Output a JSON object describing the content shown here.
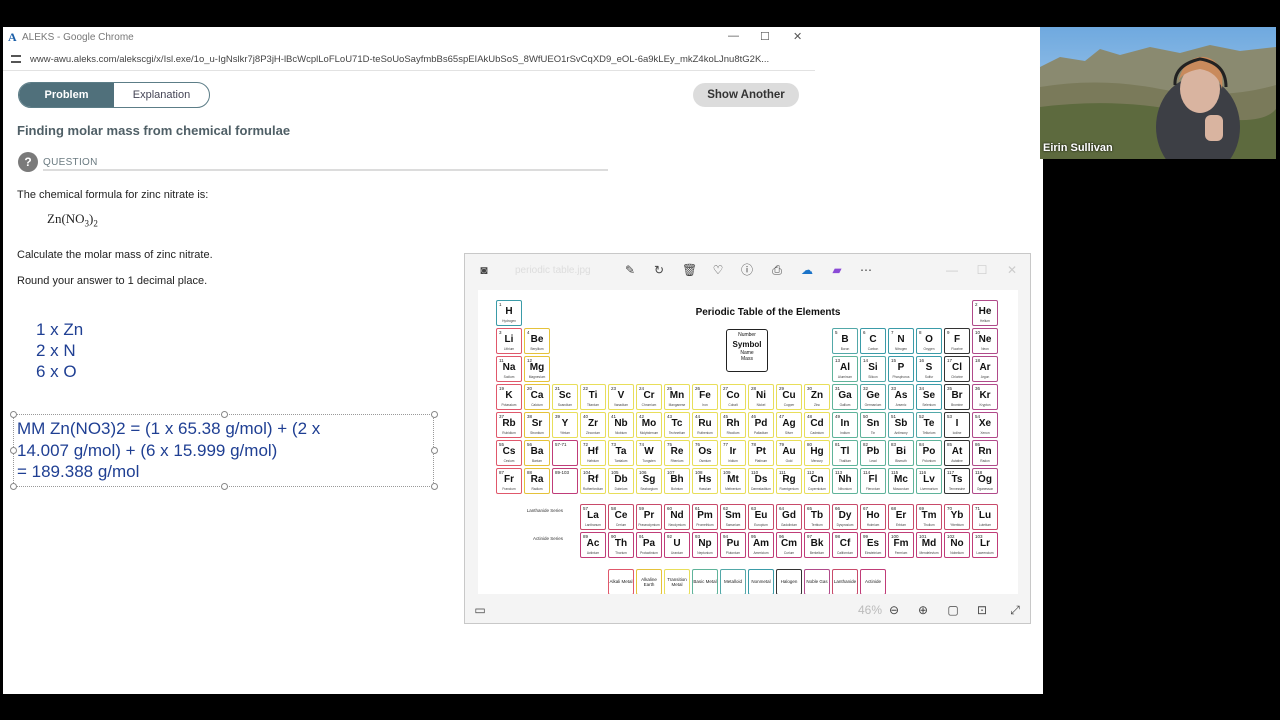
{
  "window": {
    "title": "ALEKS - Google Chrome",
    "logo_letter": "A",
    "url": "www-awu.aleks.com/alekscgi/x/Isl.exe/1o_u-IgNslkr7j8P3jH-lBcWcplLoFLoU71D-teSoUoSayfmbBs65spEIAkUbSoS_8WfUEO1rSvCqXD9_eOL-6a9kLEy_mkZ4koLJnu8tG2K..."
  },
  "tabs": {
    "problem": "Problem",
    "explanation": "Explanation"
  },
  "show_another": "Show Another",
  "heading": "Finding molar mass from chemical formulae",
  "question": {
    "icon": "?",
    "label": "QUESTION",
    "line1": "The chemical formula for zinc nitrate is:",
    "formula_main": "Zn(NO",
    "formula_sub1": "3",
    "formula_close": ")",
    "formula_sub2": "2",
    "line2": "Calculate the molar mass of zinc nitrate.",
    "line3": "Round your answer to 1 decimal place."
  },
  "handwriting": {
    "count1": "1 x Zn",
    "count2": "2 x N",
    "count3": "6 x O",
    "mm1": "MM Zn(NO3)2 = (1 x 65.38 g/mol) + (2 x",
    "mm2": "14.007 g/mol) + (6 x 15.999 g/mol)",
    "mm3": "= 189.388 g/mol"
  },
  "viewer": {
    "filename": "periodic table.jpg",
    "image_title": "Periodic Table of the Elements",
    "legend_number": "Number",
    "legend_symbol": "Symbol",
    "legend_name": "Name",
    "legend_mass": "Mass",
    "lanthanide_label": "Lanthanide Series",
    "actinide_label": "Actinide Series",
    "zoom": "46%"
  },
  "periodic": {
    "main": [
      [
        "1",
        "H",
        "Hydrogen"
      ],
      [
        "2",
        "He",
        "Helium"
      ],
      [
        "3",
        "Li",
        "Lithium"
      ],
      [
        "4",
        "Be",
        "Beryllium"
      ],
      [
        "5",
        "B",
        "Boron"
      ],
      [
        "6",
        "C",
        "Carbon"
      ],
      [
        "7",
        "N",
        "Nitrogen"
      ],
      [
        "8",
        "O",
        "Oxygen"
      ],
      [
        "9",
        "F",
        "Fluorine"
      ],
      [
        "10",
        "Ne",
        "Neon"
      ],
      [
        "11",
        "Na",
        "Sodium"
      ],
      [
        "12",
        "Mg",
        "Magnesium"
      ],
      [
        "13",
        "Al",
        "Aluminum"
      ],
      [
        "14",
        "Si",
        "Silicon"
      ],
      [
        "15",
        "P",
        "Phosphorus"
      ],
      [
        "16",
        "S",
        "Sulfur"
      ],
      [
        "17",
        "Cl",
        "Chlorine"
      ],
      [
        "18",
        "Ar",
        "Argon"
      ],
      [
        "19",
        "K",
        "Potassium"
      ],
      [
        "20",
        "Ca",
        "Calcium"
      ],
      [
        "21",
        "Sc",
        "Scandium"
      ],
      [
        "22",
        "Ti",
        "Titanium"
      ],
      [
        "23",
        "V",
        "Vanadium"
      ],
      [
        "24",
        "Cr",
        "Chromium"
      ],
      [
        "25",
        "Mn",
        "Manganese"
      ],
      [
        "26",
        "Fe",
        "Iron"
      ],
      [
        "27",
        "Co",
        "Cobalt"
      ],
      [
        "28",
        "Ni",
        "Nickel"
      ],
      [
        "29",
        "Cu",
        "Copper"
      ],
      [
        "30",
        "Zn",
        "Zinc"
      ],
      [
        "31",
        "Ga",
        "Gallium"
      ],
      [
        "32",
        "Ge",
        "Germanium"
      ],
      [
        "33",
        "As",
        "Arsenic"
      ],
      [
        "34",
        "Se",
        "Selenium"
      ],
      [
        "35",
        "Br",
        "Bromine"
      ],
      [
        "36",
        "Kr",
        "Krypton"
      ],
      [
        "37",
        "Rb",
        "Rubidium"
      ],
      [
        "38",
        "Sr",
        "Strontium"
      ],
      [
        "39",
        "Y",
        "Yttrium"
      ],
      [
        "40",
        "Zr",
        "Zirconium"
      ],
      [
        "41",
        "Nb",
        "Niobium"
      ],
      [
        "42",
        "Mo",
        "Molybdenum"
      ],
      [
        "43",
        "Tc",
        "Technetium"
      ],
      [
        "44",
        "Ru",
        "Ruthenium"
      ],
      [
        "45",
        "Rh",
        "Rhodium"
      ],
      [
        "46",
        "Pd",
        "Palladium"
      ],
      [
        "47",
        "Ag",
        "Silver"
      ],
      [
        "48",
        "Cd",
        "Cadmium"
      ],
      [
        "49",
        "In",
        "Indium"
      ],
      [
        "50",
        "Sn",
        "Tin"
      ],
      [
        "51",
        "Sb",
        "Antimony"
      ],
      [
        "52",
        "Te",
        "Tellurium"
      ],
      [
        "53",
        "I",
        "Iodine"
      ],
      [
        "54",
        "Xe",
        "Xenon"
      ],
      [
        "55",
        "Cs",
        "Cesium"
      ],
      [
        "56",
        "Ba",
        "Barium"
      ],
      [
        "57-71",
        "",
        ""
      ],
      [
        "72",
        "Hf",
        "Hafnium"
      ],
      [
        "73",
        "Ta",
        "Tantalum"
      ],
      [
        "74",
        "W",
        "Tungsten"
      ],
      [
        "75",
        "Re",
        "Rhenium"
      ],
      [
        "76",
        "Os",
        "Osmium"
      ],
      [
        "77",
        "Ir",
        "Iridium"
      ],
      [
        "78",
        "Pt",
        "Platinum"
      ],
      [
        "79",
        "Au",
        "Gold"
      ],
      [
        "80",
        "Hg",
        "Mercury"
      ],
      [
        "81",
        "Tl",
        "Thallium"
      ],
      [
        "82",
        "Pb",
        "Lead"
      ],
      [
        "83",
        "Bi",
        "Bismuth"
      ],
      [
        "84",
        "Po",
        "Polonium"
      ],
      [
        "85",
        "At",
        "Astatine"
      ],
      [
        "86",
        "Rn",
        "Radon"
      ],
      [
        "87",
        "Fr",
        "Francium"
      ],
      [
        "88",
        "Ra",
        "Radium"
      ],
      [
        "89-103",
        "",
        ""
      ],
      [
        "104",
        "Rf",
        "Rutherfordium"
      ],
      [
        "105",
        "Db",
        "Dubnium"
      ],
      [
        "106",
        "Sg",
        "Seaborgium"
      ],
      [
        "107",
        "Bh",
        "Bohrium"
      ],
      [
        "108",
        "Hs",
        "Hassium"
      ],
      [
        "109",
        "Mt",
        "Meitnerium"
      ],
      [
        "110",
        "Ds",
        "Darmstadtium"
      ],
      [
        "111",
        "Rg",
        "Roentgenium"
      ],
      [
        "112",
        "Cn",
        "Copernicium"
      ],
      [
        "113",
        "Nh",
        "Nihonium"
      ],
      [
        "114",
        "Fl",
        "Flerovium"
      ],
      [
        "115",
        "Mc",
        "Moscovium"
      ],
      [
        "116",
        "Lv",
        "Livermorium"
      ],
      [
        "117",
        "Ts",
        "Tennessine"
      ],
      [
        "118",
        "Og",
        "Oganesson"
      ]
    ],
    "lanthanides": [
      [
        "57",
        "La",
        "Lanthanum"
      ],
      [
        "58",
        "Ce",
        "Cerium"
      ],
      [
        "59",
        "Pr",
        "Praseodymium"
      ],
      [
        "60",
        "Nd",
        "Neodymium"
      ],
      [
        "61",
        "Pm",
        "Promethium"
      ],
      [
        "62",
        "Sm",
        "Samarium"
      ],
      [
        "63",
        "Eu",
        "Europium"
      ],
      [
        "64",
        "Gd",
        "Gadolinium"
      ],
      [
        "65",
        "Tb",
        "Terbium"
      ],
      [
        "66",
        "Dy",
        "Dysprosium"
      ],
      [
        "67",
        "Ho",
        "Holmium"
      ],
      [
        "68",
        "Er",
        "Erbium"
      ],
      [
        "69",
        "Tm",
        "Thulium"
      ],
      [
        "70",
        "Yb",
        "Ytterbium"
      ],
      [
        "71",
        "Lu",
        "Lutetium"
      ]
    ],
    "actinides": [
      [
        "89",
        "Ac",
        "Actinium"
      ],
      [
        "90",
        "Th",
        "Thorium"
      ],
      [
        "91",
        "Pa",
        "Protactinium"
      ],
      [
        "92",
        "U",
        "Uranium"
      ],
      [
        "93",
        "Np",
        "Neptunium"
      ],
      [
        "94",
        "Pu",
        "Plutonium"
      ],
      [
        "95",
        "Am",
        "Americium"
      ],
      [
        "96",
        "Cm",
        "Curium"
      ],
      [
        "97",
        "Bk",
        "Berkelium"
      ],
      [
        "98",
        "Cf",
        "Californium"
      ],
      [
        "99",
        "Es",
        "Einsteinium"
      ],
      [
        "100",
        "Fm",
        "Fermium"
      ],
      [
        "101",
        "Md",
        "Mendelevium"
      ],
      [
        "102",
        "No",
        "Nobelium"
      ],
      [
        "103",
        "Lr",
        "Lawrencium"
      ]
    ],
    "legend": [
      "Alkali Metal",
      "Alkaline Earth",
      "Transition Metal",
      "Basic Metal",
      "Metalloid",
      "Nonmetal",
      "Halogen",
      "Noble Gas",
      "Lanthanide",
      "Actinide"
    ],
    "colors": {
      "alkali": "#e0586b",
      "alkaline": "#e5c23a",
      "transition": "#e8de5a",
      "basic": "#5fb39a",
      "metalloid": "#52a8a8",
      "nonmetal": "#3a9ba8",
      "halogen": "#333333",
      "noble": "#b04a8a",
      "lanthanide": "#c84a6a",
      "actinide": "#c03c78",
      "hydrogen": "#3a9ba8"
    }
  },
  "webcam": {
    "name": "Eirin Sullivan"
  }
}
